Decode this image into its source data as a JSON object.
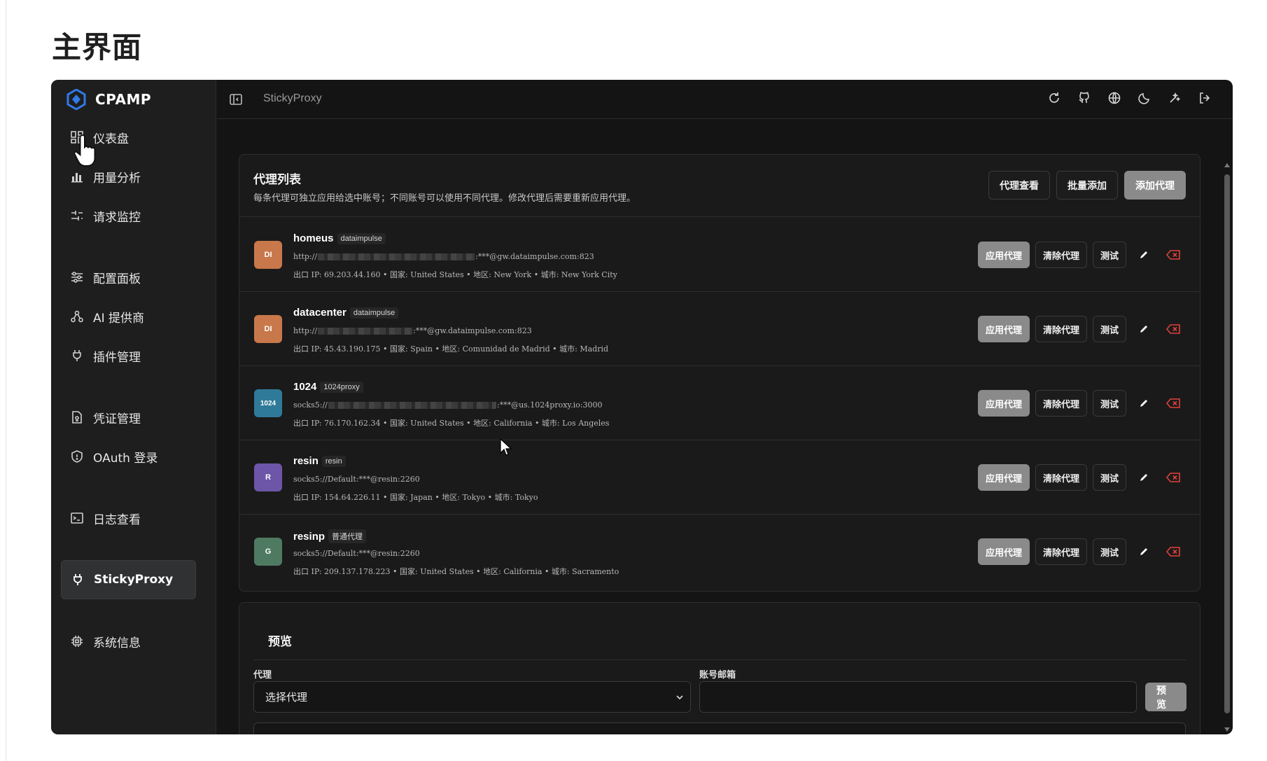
{
  "page": {
    "heading": "主界面"
  },
  "brand": {
    "name": "CPAMP"
  },
  "sidebar": {
    "items": [
      {
        "label": "仪表盘",
        "icon": "dashboard-icon"
      },
      {
        "label": "用量分析",
        "icon": "bar-chart-icon"
      },
      {
        "label": "请求监控",
        "icon": "pulse-icon"
      },
      {
        "label": "配置面板",
        "icon": "sliders-icon"
      },
      {
        "label": "AI 提供商",
        "icon": "ai-provider-icon"
      },
      {
        "label": "插件管理",
        "icon": "plug-icon"
      },
      {
        "label": "凭证管理",
        "icon": "credential-file-icon"
      },
      {
        "label": "OAuth 登录",
        "icon": "shield-icon"
      },
      {
        "label": "日志查看",
        "icon": "terminal-icon"
      },
      {
        "label": "StickyProxy",
        "icon": "plug-icon",
        "active": true
      },
      {
        "label": "系统信息",
        "icon": "chip-icon"
      }
    ]
  },
  "topbar": {
    "breadcrumb": "StickyProxy",
    "actions": [
      "refresh-icon",
      "github-icon",
      "globe-icon",
      "moon-icon",
      "sparkle-icon",
      "logout-icon"
    ]
  },
  "proxy_list": {
    "title": "代理列表",
    "description": "每条代理可独立应用给选中账号；不同账号可以使用不同代理。修改代理后需要重新应用代理。",
    "buttons": {
      "view": "代理查看",
      "bulk_add": "批量添加",
      "add": "添加代理"
    },
    "row_buttons": {
      "apply": "应用代理",
      "clear": "清除代理",
      "test": "测试"
    },
    "items": [
      {
        "avatar": "DI",
        "avatar_color": "#c8784a",
        "name": "homeus",
        "tag": "dataimpulse",
        "url_prefix": "http://",
        "url_suffix": ":***@gw.dataimpulse.com:823",
        "meta": "出口 IP: 69.203.44.160  •  国家: United States  •  地区: New York  •  城市: New York City"
      },
      {
        "avatar": "DI",
        "avatar_color": "#c8784a",
        "name": "datacenter",
        "tag": "dataimpulse",
        "url_prefix": "http://",
        "url_suffix": ":***@gw.dataimpulse.com:823",
        "meta": "出口 IP: 45.43.190.175  •  国家: Spain  •  地区: Comunidad de Madrid  •  城市: Madrid"
      },
      {
        "avatar": "1024",
        "avatar_color": "#2f7a99",
        "name": "1024",
        "tag": "1024proxy",
        "url_prefix": "socks5://",
        "url_suffix": ":***@us.1024proxy.io:3000",
        "meta": "出口 IP: 76.170.162.34  •  国家: United States  •  地区: California  •  城市: Los Angeles"
      },
      {
        "avatar": "R",
        "avatar_color": "#6d56a8",
        "name": "resin",
        "tag": "resin",
        "url_prefix": "socks5://Default:***@resin:2260",
        "url_suffix": "",
        "meta": "出口 IP: 154.64.226.11  •  国家: Japan  •  地区: Tokyo  •  城市: Tokyo"
      },
      {
        "avatar": "G",
        "avatar_color": "#4f7a62",
        "name": "resinp",
        "tag": "普通代理",
        "url_prefix": "socks5://Default:***@resin:2260",
        "url_suffix": "",
        "meta": "出口 IP: 209.137.178.223  •  国家: United States  •  地区: California  •  城市: Sacramento"
      }
    ]
  },
  "preview": {
    "title": "预览",
    "proxy_label": "代理",
    "proxy_select_value": "选择代理",
    "email_label": "账号邮箱",
    "email_value": "",
    "button": "预览"
  },
  "colors": {
    "accent_button": "#8a8a8a",
    "delete_red": "#e0413a",
    "app_bg": "#141414"
  }
}
